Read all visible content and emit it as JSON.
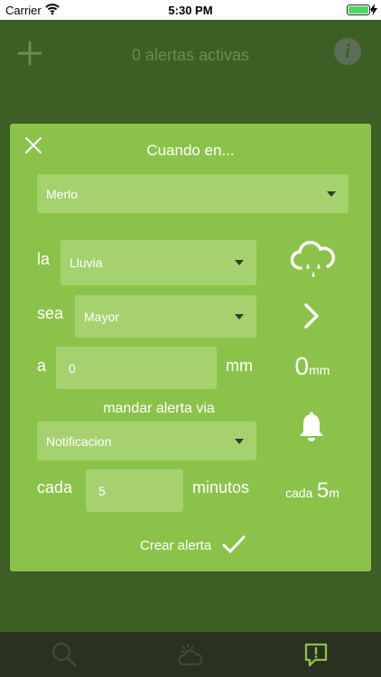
{
  "status_bar": {
    "carrier": "Carrier",
    "time": "5:30 PM"
  },
  "header": {
    "title": "0 alertas activas"
  },
  "dialog": {
    "title": "Cuando en...",
    "location": {
      "value": "Merlo"
    },
    "la_label": "la",
    "condition": {
      "value": "Lluvia"
    },
    "sea_label": "sea",
    "comparison": {
      "value": "Mayor"
    },
    "a_label": "a",
    "amount": {
      "value": "0"
    },
    "unit_label": "mm",
    "send_via_label": "mandar alerta via",
    "channel": {
      "value": "Notificacion"
    },
    "cada_label": "cada",
    "interval": {
      "value": "5"
    },
    "interval_unit": "minutos",
    "summary_value": "0",
    "summary_unit": "mm",
    "summary_interval_prefix": "cada",
    "summary_interval_value": "5",
    "summary_interval_unit": "m",
    "create_label": "Crear alerta"
  },
  "icons": {
    "status": [
      "wifi-icon",
      "battery-icon",
      "charging-icon"
    ],
    "header": [
      "add-icon",
      "info-icon"
    ],
    "dialog": [
      "close-icon",
      "cloud-rain-icon",
      "chevron-right-icon",
      "bell-icon",
      "checkmark-icon"
    ],
    "tabs": [
      "search-icon",
      "weather-icon",
      "alerts-icon"
    ]
  },
  "colors": {
    "background": "#3b5f25",
    "dialog": "#8bc34a",
    "field": "#a5d26f",
    "tab_bar": "#2a3120",
    "active_tab": "#8bc34a"
  }
}
